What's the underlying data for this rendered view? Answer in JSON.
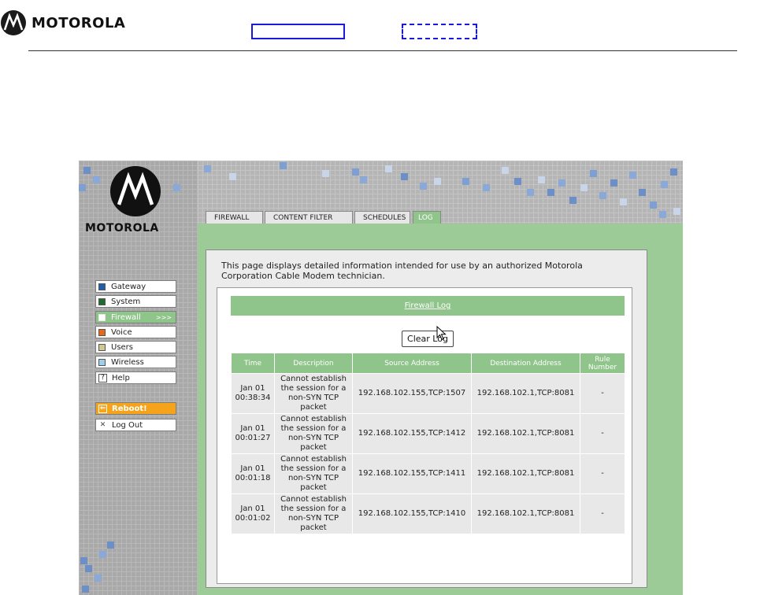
{
  "header": {
    "brand": "MOTOROLA"
  },
  "sidebar": {
    "brand": "MOTOROLA",
    "nav": [
      {
        "label": "Gateway",
        "color": "#1f5fa8"
      },
      {
        "label": "System",
        "color": "#1e6b2c"
      },
      {
        "label": "Firewall",
        "color": "#ffffff",
        "active": true,
        "arrows": ">>>"
      },
      {
        "label": "Voice",
        "color": "#e06a1e"
      },
      {
        "label": "Users",
        "color": "#cfc990"
      },
      {
        "label": "Wireless",
        "color": "#9ccfe8"
      },
      {
        "label": "Help",
        "glyph": "?"
      }
    ],
    "reboot_label": "Reboot!",
    "logout_label": "Log Out"
  },
  "tabs": [
    {
      "label": "FIREWALL"
    },
    {
      "label": "CONTENT FILTER"
    },
    {
      "label": "SCHEDULES"
    },
    {
      "label": "LOG",
      "active": true
    }
  ],
  "main": {
    "intro": "This page displays detailed information intended for use by an authorized Motorola Corporation Cable Modem technician.",
    "section_title": "Firewall Log",
    "clear_button": "Clear Log"
  },
  "log_table": {
    "columns": [
      "Time",
      "Description",
      "Source Address",
      "Destination Address",
      "Rule Number"
    ],
    "rows": [
      {
        "date": "Jan 01",
        "time": "00:38:34",
        "description": "Cannot establish the session for a non-SYN TCP packet",
        "source": "192.168.102.155,TCP:1507",
        "destination": "192.168.102.1,TCP:8081",
        "rule": "-"
      },
      {
        "date": "Jan 01",
        "time": "00:01:27",
        "description": "Cannot establish the session for a non-SYN TCP packet",
        "source": "192.168.102.155,TCP:1412",
        "destination": "192.168.102.1,TCP:8081",
        "rule": "-"
      },
      {
        "date": "Jan 01",
        "time": "00:01:18",
        "description": "Cannot establish the session for a non-SYN TCP packet",
        "source": "192.168.102.155,TCP:1411",
        "destination": "192.168.102.1,TCP:8081",
        "rule": "-"
      },
      {
        "date": "Jan 01",
        "time": "00:01:02",
        "description": "Cannot establish the session for a non-SYN TCP packet",
        "source": "192.168.102.155,TCP:1410",
        "destination": "192.168.102.1,TCP:8081",
        "rule": "-"
      }
    ]
  },
  "colors": {
    "accent_green": "#8fc48a",
    "reboot_orange": "#f5a31a",
    "annotation_blue": "#1a1adb"
  }
}
